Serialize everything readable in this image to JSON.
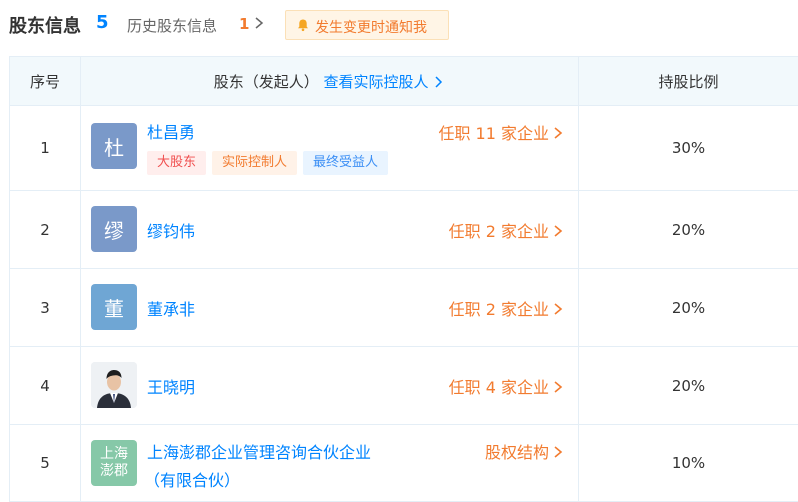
{
  "header": {
    "title": "股东信息",
    "count": "5",
    "history_label": "历史股东信息",
    "history_count": "1",
    "notify_label": "发生变更时通知我"
  },
  "table": {
    "col_index": "序号",
    "col_shareholder": "股东（发起人）",
    "col_controller_link": "查看实际控股人",
    "col_ratio": "持股比例",
    "rows": [
      {
        "index": "1",
        "avatar_text": "杜",
        "avatar_color": "#7a99c9",
        "name": "杜昌勇",
        "position": "任职 11 家企业",
        "tags": [
          "大股东",
          "实际控制人",
          "最终受益人"
        ],
        "ratio": "30%"
      },
      {
        "index": "2",
        "avatar_text": "缪",
        "avatar_color": "#7a99c9",
        "name": "缪钧伟",
        "position": "任职 2 家企业",
        "ratio": "20%"
      },
      {
        "index": "3",
        "avatar_text": "董",
        "avatar_color": "#6fa6d4",
        "name": "董承非",
        "position": "任职 2 家企业",
        "ratio": "20%"
      },
      {
        "index": "4",
        "avatar_icon": "person-photo",
        "name": "王晓明",
        "position": "任职 4 家企业",
        "ratio": "20%"
      },
      {
        "index": "5",
        "avatar_text_line1": "上海",
        "avatar_text_line2": "澎郡",
        "avatar_color": "#86c8a8",
        "name_line1": "上海澎郡企业管理咨询合伙企业",
        "name_line2": "（有限合伙）",
        "position": "股权结构",
        "ratio": "10%"
      }
    ]
  },
  "colors": {
    "accent_blue": "#0084ff",
    "accent_orange": "#f27b2f",
    "header_bg": "#f2f9fc",
    "border": "#e4eef6"
  }
}
